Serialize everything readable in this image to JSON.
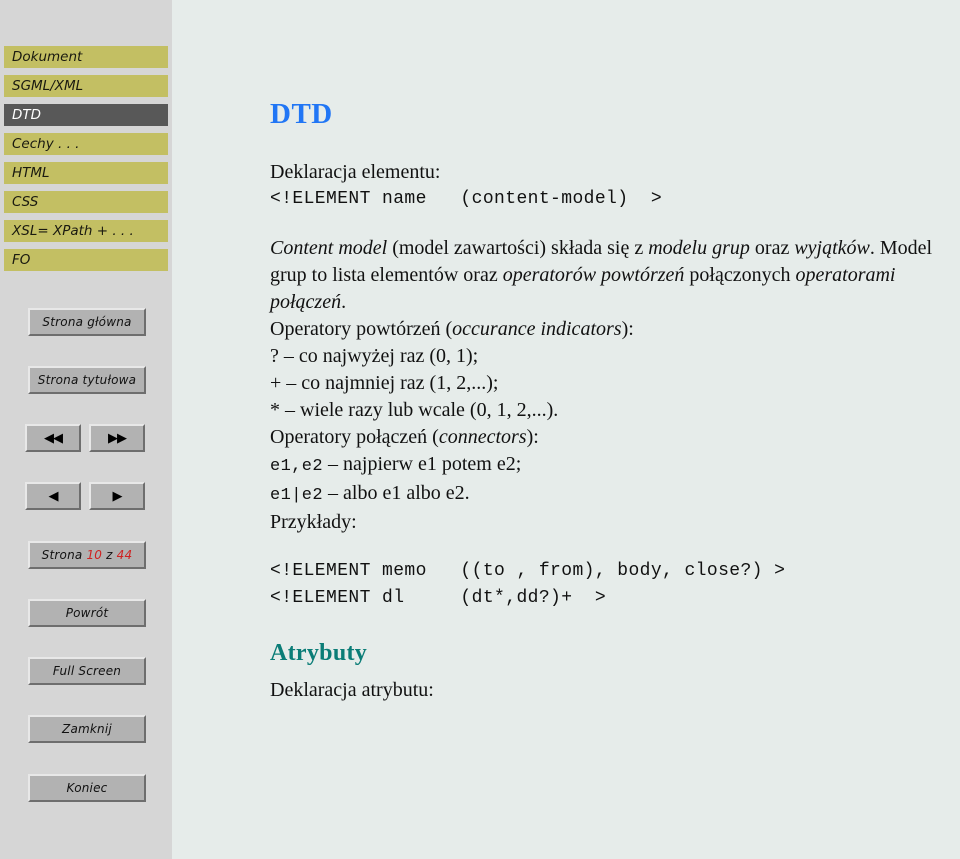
{
  "sidebar": {
    "nav_items": [
      {
        "label": "Dokument",
        "active": false
      },
      {
        "label": "SGML/XML",
        "active": false
      },
      {
        "label": "DTD",
        "active": true
      },
      {
        "label": "Cechy . . .",
        "active": false
      },
      {
        "label": "HTML",
        "active": false
      },
      {
        "label": "CSS",
        "active": false
      },
      {
        "label": "XSL= XPath + . . .",
        "active": false
      },
      {
        "label": "FO",
        "active": false
      }
    ],
    "buttons": {
      "home": "Strona główna",
      "title_page": "Strona tytułowa",
      "first": "◀◀",
      "last": "▶▶",
      "prev": "◀",
      "next": "▶",
      "back": "Powrót",
      "full_screen": "Full Screen",
      "close": "Zamknij",
      "quit": "Koniec"
    },
    "page_counter": {
      "prefix": "Strona",
      "current": "10",
      "separator": "z",
      "total": "44"
    }
  },
  "main": {
    "title": "DTD",
    "element_decl_label": "Deklaracja elementu:",
    "element_decl_code": "<!ELEMENT name   (content-model)  >",
    "paragraph": {
      "p1_i1": "Content model",
      "p1_t1": " (model zawartości) składa się z ",
      "p1_i2": "modelu grup",
      "p1_t2": " oraz ",
      "p1_i3": "wyjątków",
      "p1_t3": ". Model grup to lista elementów oraz ",
      "p1_i4": "operatorów powtórzeń",
      "p1_t4": " połączonych ",
      "p1_i5": "operatorami połączeń",
      "p1_t5": "."
    },
    "occurrence_heading_pre": "Operatory powtórzeń (",
    "occurrence_heading_i": "occurance indicators",
    "occurrence_heading_post": "):",
    "occurrence_items": [
      "? – co najwyżej raz (0, 1);",
      "+ – co najmniej raz (1, 2,...);",
      "* – wiele razy lub wcale (0, 1, 2,...)."
    ],
    "connectors_heading_pre": "Operatory połączeń (",
    "connectors_heading_i": "connectors",
    "connectors_heading_post": "):",
    "connector_items": [
      {
        "code": "e1,e2",
        "text": " – najpierw e1 potem e2;"
      },
      {
        "code": "e1|e2",
        "text": " – albo e1 albo e2."
      }
    ],
    "examples_label": "Przykłady:",
    "examples_code": [
      "<!ELEMENT memo   ((to , from), body, close?) >",
      "<!ELEMENT dl     (dt*,dd?)+  >"
    ],
    "attributes_title": "Atrybuty",
    "attribute_decl_label": "Deklaracja atrybutu:"
  },
  "colors": {
    "nav_item_bg": "#c3bf63",
    "nav_item_active_bg": "#585858",
    "sidebar_bg": "#d6d6d6",
    "main_bg": "#e6ecea",
    "title_blue": "#2176f5",
    "section_teal": "#0b7d77",
    "counter_red": "#cf2222",
    "button_gray": "#b2b2b2"
  }
}
